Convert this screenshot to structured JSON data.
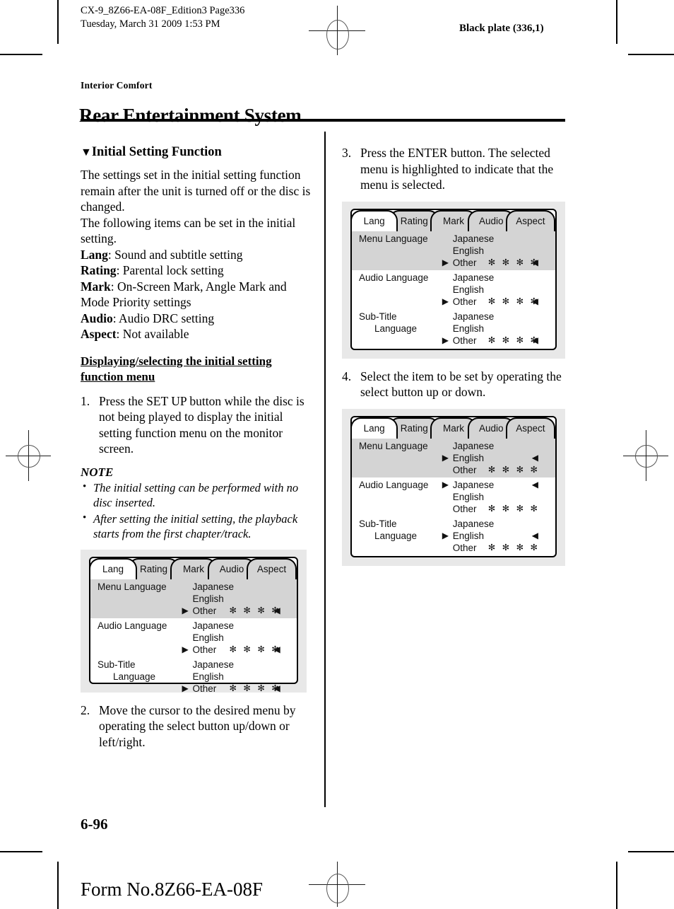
{
  "print_marks": {
    "file_line1": "CX-9_8Z66-EA-08F_Edition3 Page336",
    "file_line2": "Tuesday, March 31 2009 1:53 PM",
    "black_plate": "Black plate (336,1)",
    "form_no": "Form No.8Z66-EA-08F"
  },
  "header": {
    "kicker": "Interior Comfort",
    "title": "Rear Entertainment System"
  },
  "footer": {
    "folio": "6-96"
  },
  "left_column": {
    "section_marker": "▼",
    "section_title": "Initial Setting Function",
    "intro": "The settings set in the initial setting function remain after the unit is turned off or the disc is changed.\nThe following items can be set in the initial setting.",
    "definitions": [
      {
        "term": "Lang",
        "desc": ": Sound and subtitle setting"
      },
      {
        "term": "Rating",
        "desc": ": Parental lock setting"
      },
      {
        "term": "Mark",
        "desc": ": On-Screen Mark, Angle Mark and Mode Priority settings"
      },
      {
        "term": "Audio",
        "desc": ": Audio DRC setting"
      },
      {
        "term": "Aspect",
        "desc": ": Not available"
      }
    ],
    "sub_head": "Displaying/selecting the initial setting function menu",
    "step1_num": "1.",
    "step1_text": "Press the SET UP button while the disc is not being played to display the initial setting function menu on the monitor screen.",
    "note_title": "NOTE",
    "note_bullet": "•",
    "notes": [
      "The initial setting can be performed with no disc inserted.",
      "After setting the initial setting, the playback starts from the first chapter/track."
    ],
    "step2_num": "2.",
    "step2_text": "Move the cursor to the desired menu by operating the select button up/down or left/right."
  },
  "right_column": {
    "step3_num": "3.",
    "step3_text": "Press the ENTER button. The selected menu is highlighted to indicate that the menu is selected.",
    "step4_num": "4.",
    "step4_text": "Select the item to be set by operating the select button up or down."
  },
  "glyphs": {
    "cursor_right": "▶",
    "arrow_left": "◀",
    "star": "✻",
    "stars4": "✻ ✻ ✻ ✻"
  },
  "screens": {
    "tabs": [
      "Lang",
      "Rating",
      "Mark",
      "Audio",
      "Aspect"
    ],
    "active_tab": "Lang",
    "figure1": {
      "groups": [
        {
          "label": "Menu Language",
          "label_line2": "",
          "highlighted": true,
          "options": [
            {
              "text": "Japanese",
              "cursor": false,
              "stars": false,
              "arrow": false
            },
            {
              "text": "English",
              "cursor": false,
              "stars": false,
              "arrow": false
            },
            {
              "text": "Other",
              "cursor": true,
              "stars": true,
              "arrow": true
            }
          ]
        },
        {
          "label": "Audio Language",
          "label_line2": "",
          "highlighted": false,
          "options": [
            {
              "text": "Japanese",
              "cursor": false,
              "stars": false,
              "arrow": false
            },
            {
              "text": "English",
              "cursor": false,
              "stars": false,
              "arrow": false
            },
            {
              "text": "Other",
              "cursor": true,
              "stars": true,
              "arrow": true
            }
          ]
        },
        {
          "label": "Sub-Title",
          "label_line2": "Language",
          "highlighted": false,
          "options": [
            {
              "text": "Japanese",
              "cursor": false,
              "stars": false,
              "arrow": false
            },
            {
              "text": "English",
              "cursor": false,
              "stars": false,
              "arrow": false
            },
            {
              "text": "Other",
              "cursor": true,
              "stars": true,
              "arrow": true
            }
          ]
        }
      ]
    },
    "figure2": {
      "groups": [
        {
          "label": "Menu Language",
          "label_line2": "",
          "highlighted": true,
          "options": [
            {
              "text": "Japanese",
              "cursor": false,
              "stars": false,
              "arrow": false
            },
            {
              "text": "English",
              "cursor": false,
              "stars": false,
              "arrow": false
            },
            {
              "text": "Other",
              "cursor": true,
              "stars": true,
              "arrow": true
            }
          ]
        },
        {
          "label": "Audio Language",
          "label_line2": "",
          "highlighted": false,
          "options": [
            {
              "text": "Japanese",
              "cursor": false,
              "stars": false,
              "arrow": false
            },
            {
              "text": "English",
              "cursor": false,
              "stars": false,
              "arrow": false
            },
            {
              "text": "Other",
              "cursor": true,
              "stars": true,
              "arrow": true
            }
          ]
        },
        {
          "label": "Sub-Title",
          "label_line2": "Language",
          "highlighted": false,
          "options": [
            {
              "text": "Japanese",
              "cursor": false,
              "stars": false,
              "arrow": false
            },
            {
              "text": "English",
              "cursor": false,
              "stars": false,
              "arrow": false
            },
            {
              "text": "Other",
              "cursor": true,
              "stars": true,
              "arrow": true
            }
          ]
        }
      ]
    },
    "figure3": {
      "groups": [
        {
          "label": "Menu Language",
          "label_line2": "",
          "highlighted": true,
          "options": [
            {
              "text": "Japanese",
              "cursor": false,
              "stars": false,
              "arrow": false
            },
            {
              "text": "English",
              "cursor": true,
              "stars": false,
              "arrow": true
            },
            {
              "text": "Other",
              "cursor": false,
              "stars": true,
              "arrow": false
            }
          ]
        },
        {
          "label": "Audio Language",
          "label_line2": "",
          "highlighted": false,
          "options": [
            {
              "text": "Japanese",
              "cursor": true,
              "stars": false,
              "arrow": true
            },
            {
              "text": "English",
              "cursor": false,
              "stars": false,
              "arrow": false
            },
            {
              "text": "Other",
              "cursor": false,
              "stars": true,
              "arrow": false
            }
          ]
        },
        {
          "label": "Sub-Title",
          "label_line2": "Language",
          "highlighted": false,
          "options": [
            {
              "text": "Japanese",
              "cursor": false,
              "stars": false,
              "arrow": false
            },
            {
              "text": "English",
              "cursor": true,
              "stars": false,
              "arrow": true
            },
            {
              "text": "Other",
              "cursor": false,
              "stars": true,
              "arrow": false
            }
          ]
        }
      ]
    }
  }
}
